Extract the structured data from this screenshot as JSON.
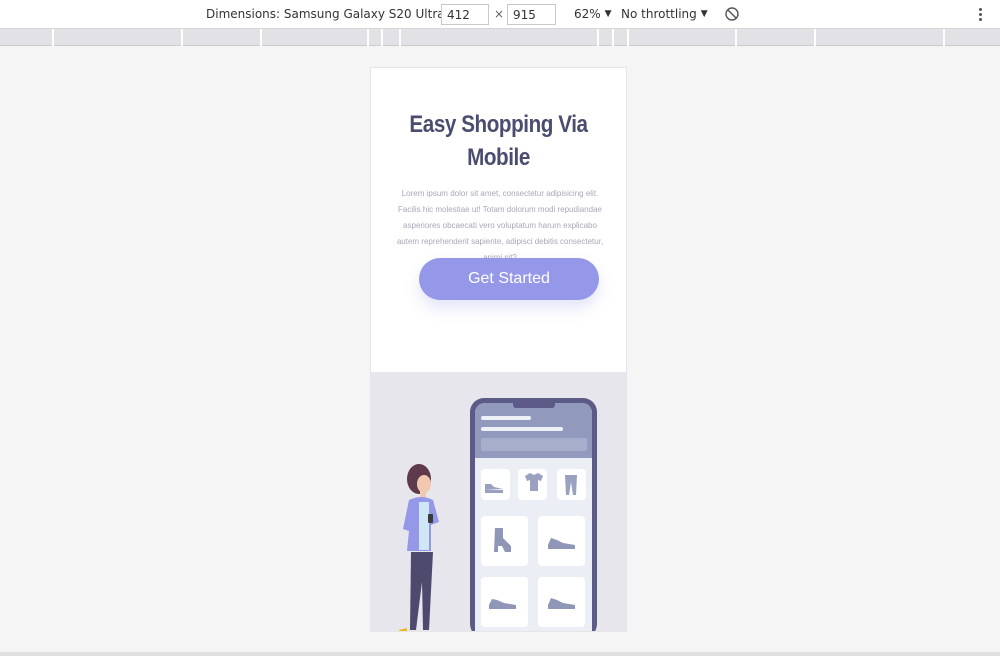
{
  "toolbar": {
    "device_label": "Dimensions: Samsung Galaxy S20 Ultra",
    "width_value": "412",
    "height_value": "915",
    "times_symbol": "×",
    "zoom_label": "62%",
    "throttle_label": "No throttling",
    "dropdown_arrow": "▼",
    "rotate_icon": "rotate-icon",
    "more_icon": "more-vertical-icon"
  },
  "page": {
    "title": "Easy Shopping Via Mobile",
    "description": "Lorem ipsum dolor sit amet, consectetur adipisicing elit. Facilis hic molestiae ut! Totam dolorum modi repudiandae asperiores obcaecati vero voluptatum harum explicabo autem reprehenderit sapiente, adipisci debitis consectetur, animi sit?",
    "cta_label": "Get Started"
  },
  "colors": {
    "accent": "#9598e8",
    "title": "#4a4c70",
    "body_text": "#a7a8b8",
    "illustration_bg": "#e7e6ec",
    "phone_frame": "#5c5a86"
  }
}
